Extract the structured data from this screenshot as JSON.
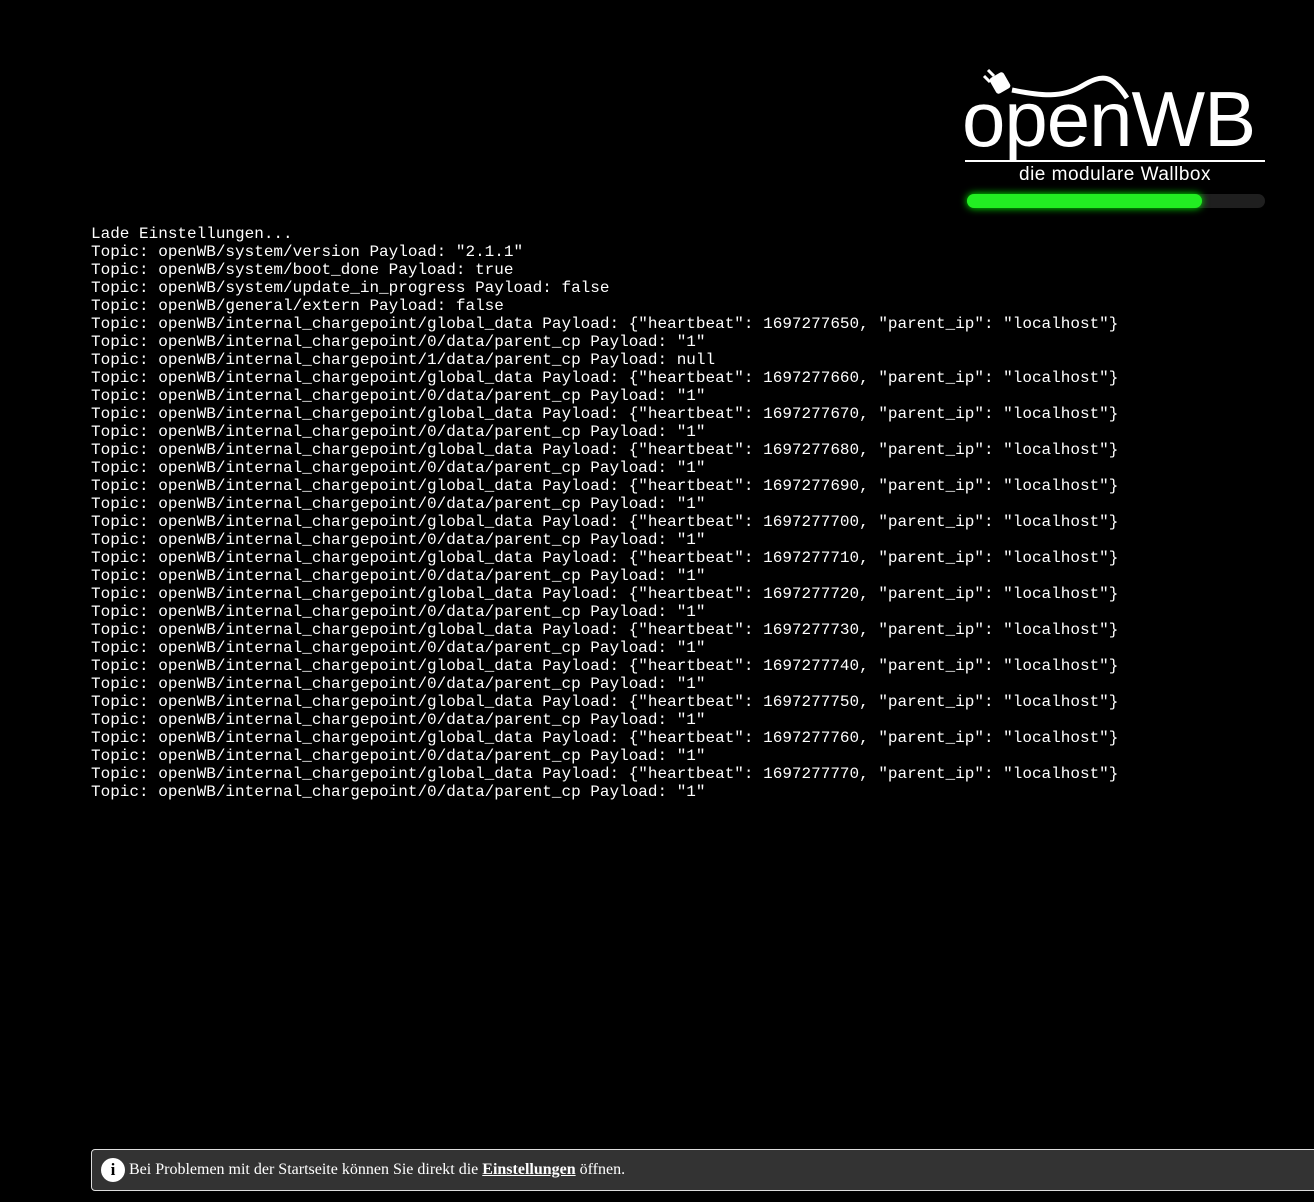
{
  "logo": {
    "title": "openWB",
    "subtitle": "die modulare Wallbox"
  },
  "loading_progress_percent": 79,
  "log": [
    "Lade Einstellungen...",
    "Topic: openWB/system/version Payload: \"2.1.1\"",
    "Topic: openWB/system/boot_done Payload: true",
    "Topic: openWB/system/update_in_progress Payload: false",
    "Topic: openWB/general/extern Payload: false",
    "Topic: openWB/internal_chargepoint/global_data Payload: {\"heartbeat\": 1697277650, \"parent_ip\": \"localhost\"}",
    "Topic: openWB/internal_chargepoint/0/data/parent_cp Payload: \"1\"",
    "Topic: openWB/internal_chargepoint/1/data/parent_cp Payload: null",
    "Topic: openWB/internal_chargepoint/global_data Payload: {\"heartbeat\": 1697277660, \"parent_ip\": \"localhost\"}",
    "Topic: openWB/internal_chargepoint/0/data/parent_cp Payload: \"1\"",
    "Topic: openWB/internal_chargepoint/global_data Payload: {\"heartbeat\": 1697277670, \"parent_ip\": \"localhost\"}",
    "Topic: openWB/internal_chargepoint/0/data/parent_cp Payload: \"1\"",
    "Topic: openWB/internal_chargepoint/global_data Payload: {\"heartbeat\": 1697277680, \"parent_ip\": \"localhost\"}",
    "Topic: openWB/internal_chargepoint/0/data/parent_cp Payload: \"1\"",
    "Topic: openWB/internal_chargepoint/global_data Payload: {\"heartbeat\": 1697277690, \"parent_ip\": \"localhost\"}",
    "Topic: openWB/internal_chargepoint/0/data/parent_cp Payload: \"1\"",
    "Topic: openWB/internal_chargepoint/global_data Payload: {\"heartbeat\": 1697277700, \"parent_ip\": \"localhost\"}",
    "Topic: openWB/internal_chargepoint/0/data/parent_cp Payload: \"1\"",
    "Topic: openWB/internal_chargepoint/global_data Payload: {\"heartbeat\": 1697277710, \"parent_ip\": \"localhost\"}",
    "Topic: openWB/internal_chargepoint/0/data/parent_cp Payload: \"1\"",
    "Topic: openWB/internal_chargepoint/global_data Payload: {\"heartbeat\": 1697277720, \"parent_ip\": \"localhost\"}",
    "Topic: openWB/internal_chargepoint/0/data/parent_cp Payload: \"1\"",
    "Topic: openWB/internal_chargepoint/global_data Payload: {\"heartbeat\": 1697277730, \"parent_ip\": \"localhost\"}",
    "Topic: openWB/internal_chargepoint/0/data/parent_cp Payload: \"1\"",
    "Topic: openWB/internal_chargepoint/global_data Payload: {\"heartbeat\": 1697277740, \"parent_ip\": \"localhost\"}",
    "Topic: openWB/internal_chargepoint/0/data/parent_cp Payload: \"1\"",
    "Topic: openWB/internal_chargepoint/global_data Payload: {\"heartbeat\": 1697277750, \"parent_ip\": \"localhost\"}",
    "Topic: openWB/internal_chargepoint/0/data/parent_cp Payload: \"1\"",
    "Topic: openWB/internal_chargepoint/global_data Payload: {\"heartbeat\": 1697277760, \"parent_ip\": \"localhost\"}",
    "Topic: openWB/internal_chargepoint/0/data/parent_cp Payload: \"1\"",
    "Topic: openWB/internal_chargepoint/global_data Payload: {\"heartbeat\": 1697277770, \"parent_ip\": \"localhost\"}",
    "Topic: openWB/internal_chargepoint/0/data/parent_cp Payload: \"1\""
  ],
  "banner": {
    "icon": "info-icon",
    "text_before": "Bei Problemen mit der Startseite können Sie direkt die",
    "link": "Einstellungen",
    "text_after": "öffnen."
  }
}
